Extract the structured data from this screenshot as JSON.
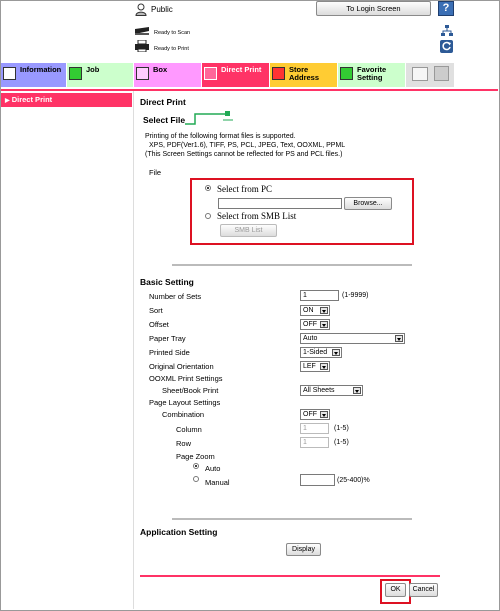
{
  "header": {
    "user_label": "Public",
    "login_button": "To Login Screen",
    "help_label": "?",
    "status_scan": "Ready to Scan",
    "status_print": "Ready to Print"
  },
  "tabs": [
    {
      "label": "Information",
      "color": "#9999ff"
    },
    {
      "label": "Job",
      "color": "#ccffcc"
    },
    {
      "label": "Box",
      "color": "#ff99ff"
    },
    {
      "label": "Direct Print",
      "color": "#ff3366"
    },
    {
      "label": "Store Address",
      "color": "#ffcc33"
    },
    {
      "label": "Favorite Setting",
      "color": "#ccffcc"
    }
  ],
  "sidebar": {
    "items": [
      {
        "label": "Direct Print"
      }
    ]
  },
  "main": {
    "title": "Direct Print",
    "select_file": {
      "heading": "Select File",
      "desc1": "Printing of the following format files is supported.",
      "desc2": "XPS, PDF(Ver1.6), TIFF, PS, PCL, JPEG, Text, OOXML, PPML",
      "desc3": "(This Screen Settings cannot be reflected for PS and PCL files.)",
      "file_label": "File",
      "opt_pc": "Select from PC",
      "browse": "Browse...",
      "opt_smb": "Select from SMB List",
      "smb_button": "SMB List"
    },
    "basic": {
      "heading": "Basic Setting",
      "number_of_sets": {
        "label": "Number of Sets",
        "value": "1",
        "hint": "(1-9999)"
      },
      "sort": {
        "label": "Sort",
        "value": "ON"
      },
      "offset": {
        "label": "Offset",
        "value": "OFF"
      },
      "paper_tray": {
        "label": "Paper Tray",
        "value": "Auto"
      },
      "printed_side": {
        "label": "Printed Side",
        "value": "1-Sided"
      },
      "orientation": {
        "label": "Original Orientation",
        "value": "LEF"
      },
      "ooxml": {
        "label": "OOXML Print Settings"
      },
      "sheet_book": {
        "label": "Sheet/Book Print",
        "value": "All Sheets"
      },
      "page_layout": {
        "label": "Page Layout Settings"
      },
      "combination": {
        "label": "Combination",
        "value": "OFF"
      },
      "column": {
        "label": "Column",
        "value": "1",
        "hint": "(1-5)"
      },
      "row": {
        "label": "Row",
        "value": "1",
        "hint": "(1-5)"
      },
      "page_zoom": {
        "label": "Page Zoom"
      },
      "zoom_auto": "Auto",
      "zoom_manual": "Manual",
      "zoom_hint": "(25-400)%"
    },
    "application": {
      "heading": "Application Setting",
      "display": "Display"
    },
    "ok": "OK",
    "cancel": "Cancel"
  }
}
